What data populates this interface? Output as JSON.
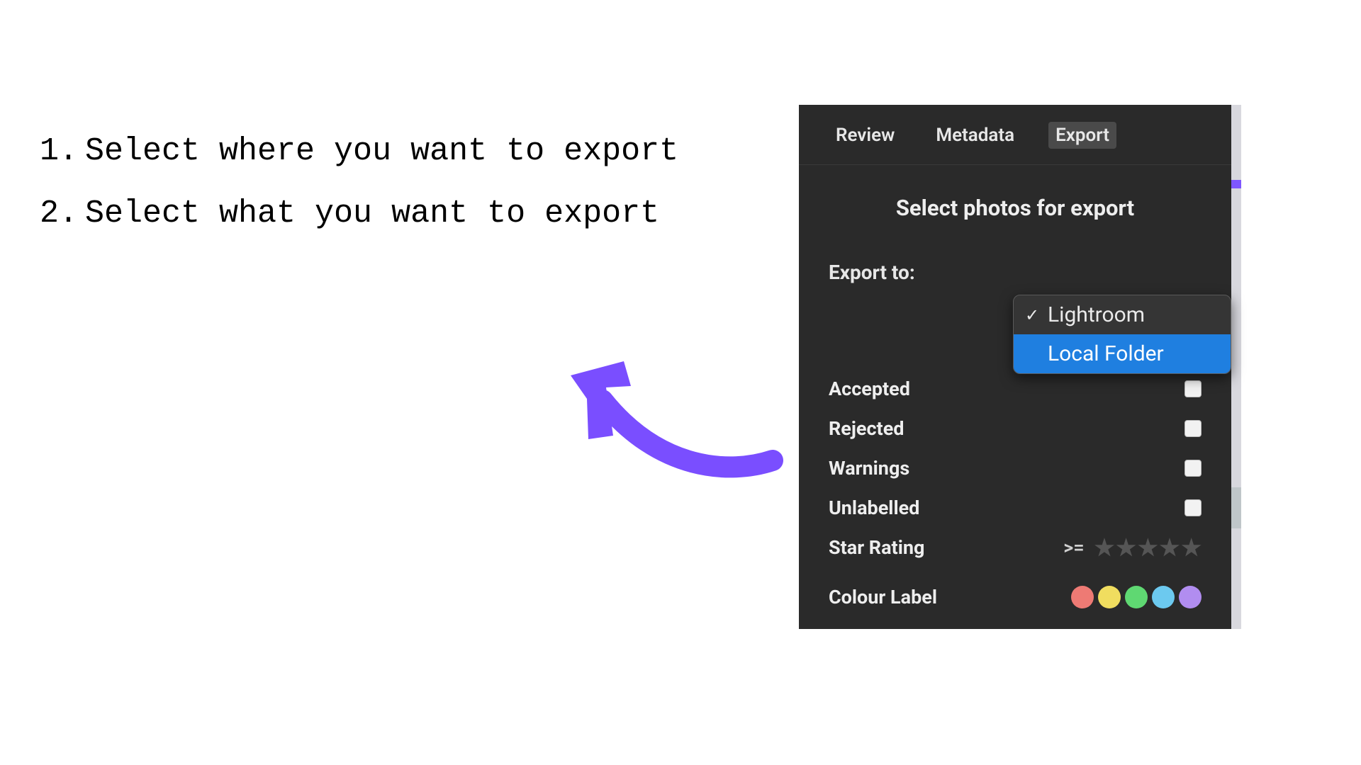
{
  "instructions": {
    "items": [
      {
        "num": "1.",
        "text": "Select where you want to export"
      },
      {
        "num": "2.",
        "text": "Select what you want to export"
      }
    ]
  },
  "panel": {
    "tabs": {
      "review": "Review",
      "metadata": "Metadata",
      "export": "Export",
      "active": "Export"
    },
    "title": "Select photos for export",
    "export_to_label": "Export to:",
    "dropdown": {
      "options": [
        {
          "label": "Lightroom",
          "selected": true
        },
        {
          "label": "Local Folder",
          "selected": false,
          "highlighted": true
        }
      ]
    },
    "filters": {
      "accepted": "Accepted",
      "rejected": "Rejected",
      "warnings": "Warnings",
      "unlabelled": "Unlabelled",
      "star_rating_label": "Star Rating",
      "star_rating_op": ">=",
      "star_rating_value": 0,
      "colour_label": "Colour Label",
      "colours": [
        "#ee7a74",
        "#f0dd5f",
        "#5fd872",
        "#6cc9ef",
        "#b18df0"
      ]
    }
  },
  "arrow_color": "#7a4eff"
}
